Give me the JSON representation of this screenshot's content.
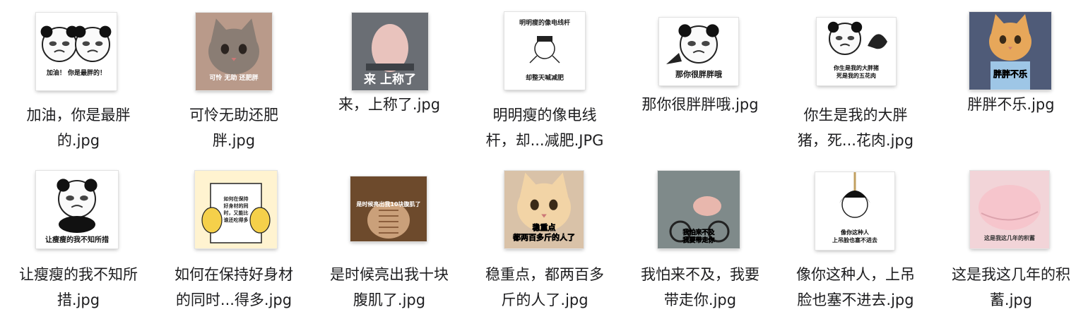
{
  "files": [
    {
      "name_lines": [
        "加油，你是最胖",
        "的.jpg"
      ],
      "caption": "加油！ 你是最胖的！",
      "icon": "panda-meme-thumbnail"
    },
    {
      "name_lines": [
        "可怜无助还肥",
        "胖.jpg"
      ],
      "caption": "可怜 无助 还肥胖",
      "icon": "cat-photo-thumbnail"
    },
    {
      "name_lines": [
        "来，上称了.jpg"
      ],
      "caption": "来 上称了",
      "icon": "pig-photo-thumbnail"
    },
    {
      "name_lines": [
        "明明瘦的像电线",
        "杆，却...减肥.JPG"
      ],
      "caption": "明明瘦的像电线杆",
      "caption2": "却整天喊减肥",
      "icon": "cartoon-meme-thumbnail"
    },
    {
      "name_lines": [
        "那你很胖胖哦.jpg"
      ],
      "caption": "那你很胖胖哦",
      "icon": "panda-meme-thumbnail"
    },
    {
      "name_lines": [
        "你生是我的大胖",
        "猪，死...花肉.jpg"
      ],
      "caption": "你生是我的大胖猪",
      "caption2": "死是我的五花肉",
      "icon": "panda-meme-thumbnail"
    },
    {
      "name_lines": [
        "胖胖不乐.jpg"
      ],
      "caption": "胖胖不乐",
      "icon": "cat-photo-thumbnail"
    },
    {
      "name_lines": [
        "让瘦瘦的我不知所",
        "措.jpg"
      ],
      "caption": "让瘦瘦的我不知所措",
      "icon": "panda-meme-thumbnail"
    },
    {
      "name_lines": [
        "如何在保持好身材",
        "的同时...得多.jpg"
      ],
      "caption": "如何在保持好身材的同时，又能比谁还吃得多",
      "icon": "cartoon-book-thumbnail"
    },
    {
      "name_lines": [
        "是时候亮出我十块",
        "腹肌了.jpg"
      ],
      "caption": "是时候亮出我10块腹肌了",
      "icon": "belly-photo-thumbnail"
    },
    {
      "name_lines": [
        "稳重点，都两百多",
        "斤的人了.jpg"
      ],
      "caption": "稳重点",
      "caption2": "都两百多斤的人了",
      "icon": "cat-photo-thumbnail"
    },
    {
      "name_lines": [
        "我怕来不及，我要",
        "带走你.jpg"
      ],
      "caption": "我怕来不及",
      "caption2": "我要带走你",
      "icon": "motorbike-photo-thumbnail"
    },
    {
      "name_lines": [
        "像你这种人，上吊",
        "脸也塞不进去.jpg"
      ],
      "caption": "像你这种人",
      "caption2": "上吊脸也塞不进去",
      "icon": "cartoon-meme-thumbnail"
    },
    {
      "name_lines": [
        "这是我这几年的积",
        "蓄.jpg"
      ],
      "caption": "这是我这几年的积蓄",
      "icon": "belly-photo-thumbnail"
    }
  ]
}
